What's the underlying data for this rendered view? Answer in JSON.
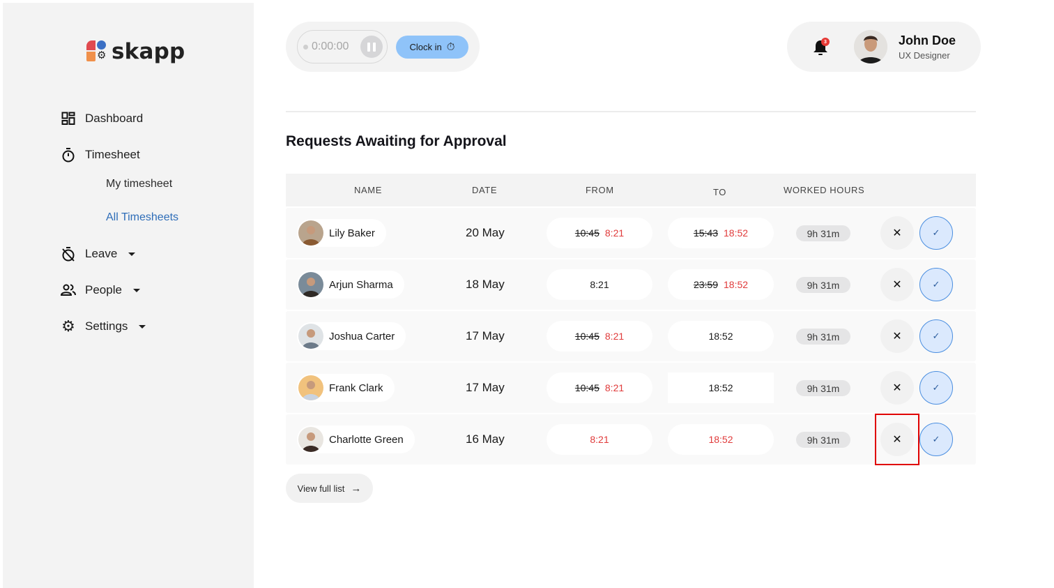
{
  "app": {
    "logo_text": "skapp"
  },
  "sidebar": {
    "items": [
      {
        "label": "Dashboard",
        "icon": "dashboard-icon"
      },
      {
        "label": "Timesheet",
        "icon": "stopwatch-icon"
      },
      {
        "label": "Leave",
        "icon": "timer-off-icon",
        "has_dropdown": true
      },
      {
        "label": "People",
        "icon": "people-icon",
        "has_dropdown": true
      },
      {
        "label": "Settings",
        "icon": "gear-icon",
        "has_dropdown": true
      }
    ],
    "sub_items": [
      {
        "label": "My timesheet",
        "active": false
      },
      {
        "label": "All Timesheets",
        "active": true
      }
    ]
  },
  "clock": {
    "timer_value": "0:00:00",
    "clock_in_label": "Clock in"
  },
  "user": {
    "name": "John Doe",
    "role": "UX Designer",
    "notification_count": "3"
  },
  "section": {
    "title": "Requests Awaiting for Approval"
  },
  "table": {
    "headers": {
      "name": "NAME",
      "date": "DATE",
      "from": "FROM",
      "to": "TO",
      "worked_hours": "WORKED HOURS"
    },
    "rows": [
      {
        "name": "Lily Baker",
        "date": "20 May",
        "from_old": "10:45",
        "from_new": "8:21",
        "to_old": "15:43",
        "to_new": "18:52",
        "hours": "9h 31m"
      },
      {
        "name": "Arjun Sharma",
        "date": "18 May",
        "from_old": "",
        "from_new": "8:21",
        "to_old": "23:59",
        "to_new": "18:52",
        "hours": "9h 31m"
      },
      {
        "name": "Joshua Carter",
        "date": "17 May",
        "from_old": "10:45",
        "from_new": "8:21",
        "to_old": "",
        "to_new": "18:52",
        "hours": "9h 31m"
      },
      {
        "name": "Frank Clark",
        "date": "17 May",
        "from_old": "10:45",
        "from_new": "8:21",
        "to_old": "",
        "to_new": "18:52",
        "hours": "9h 31m"
      },
      {
        "name": "Charlotte Green",
        "date": "16 May",
        "from_old": "",
        "from_new": "8:21",
        "to_old": "",
        "to_new": "18:52",
        "hours": "9h 31m"
      }
    ],
    "reject_symbol": "✕",
    "approve_symbol": "✓"
  },
  "footer": {
    "view_full_list_label": "View full list",
    "arrow_symbol": "→"
  },
  "colors": {
    "accent_blue": "#8fc3f9",
    "active_link": "#2e6db8",
    "changed_time_red": "#e03a3a",
    "badge_red": "#e53935",
    "highlight_annotation": "#e00000"
  }
}
